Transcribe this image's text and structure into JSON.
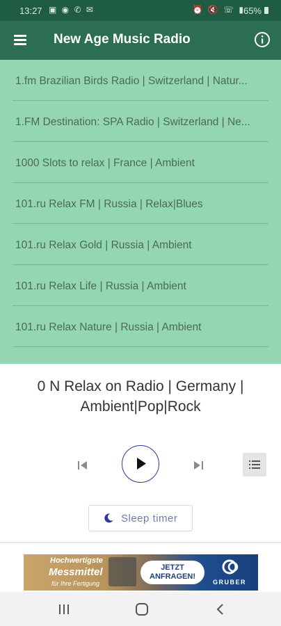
{
  "status_bar": {
    "time": "13:27",
    "left_icons": [
      "gallery-icon",
      "message-icon",
      "whatsapp-icon",
      "mail-icon"
    ],
    "right_icons": [
      "alarm-icon",
      "mute-icon",
      "wifi-call-icon",
      "signal-icon"
    ],
    "battery": "65%"
  },
  "app_bar": {
    "title": "New Age Music Radio",
    "menu_icon": "hamburger-menu-icon",
    "info_icon": "info-icon"
  },
  "stations": [
    {
      "label": "1.fm Brazilian Birds Radio | Switzerland | Natur..."
    },
    {
      "label": "1.FM Destination: SPA Radio | Switzerland | Ne..."
    },
    {
      "label": "1000 Slots to relax | France | Ambient"
    },
    {
      "label": "101.ru Relax FM | Russia | Relax|Blues"
    },
    {
      "label": "101.ru Relax Gold | Russia | Ambient"
    },
    {
      "label": "101.ru Relax Life | Russia | Ambient"
    },
    {
      "label": "101.ru Relax Nature | Russia | Ambient"
    }
  ],
  "player": {
    "now_playing": "0 N Relax on Radio | Germany | Ambient|Pop|Rock",
    "sleep_timer_label": "Sleep timer",
    "icons": [
      "previous-icon",
      "play-icon",
      "next-icon",
      "playlist-icon",
      "moon-icon"
    ]
  },
  "ad": {
    "line1": "Hochwertigste",
    "line2": "Messmittel",
    "line3": "für Ihre Fertigung",
    "cta": "JETZT ANFRAGEN!",
    "brand": "GRUBER"
  },
  "colors": {
    "status_bar": "#1f5c44",
    "app_bar": "#2b6e51",
    "list_background": "#94d6b0",
    "accent": "#2a3a96"
  }
}
